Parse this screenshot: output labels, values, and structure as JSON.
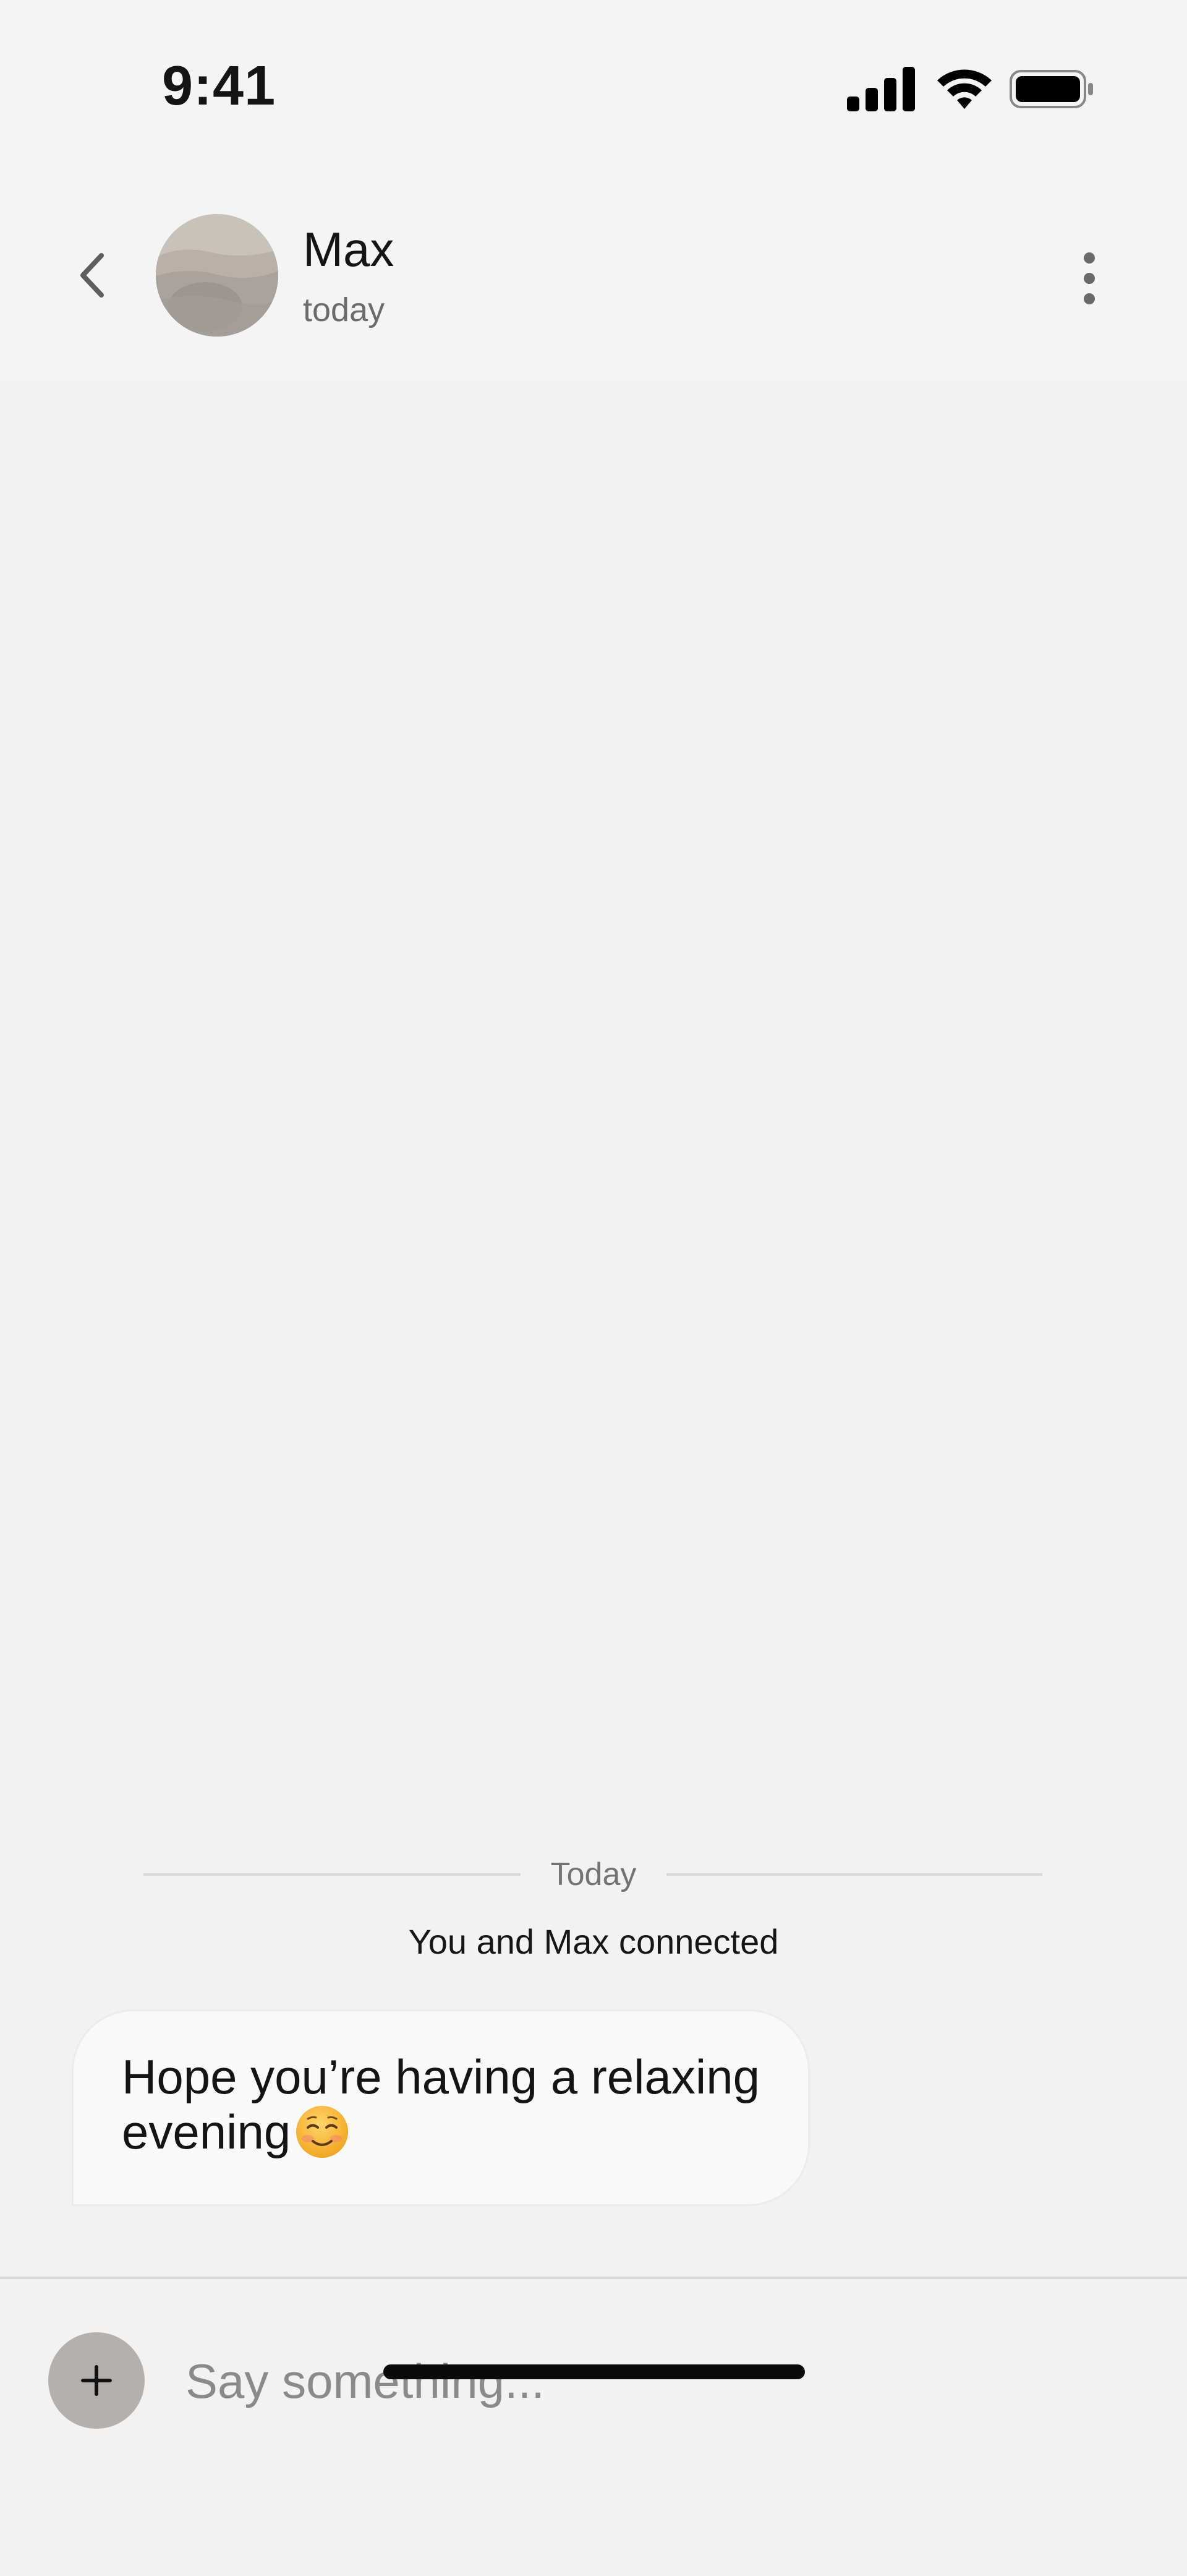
{
  "status_bar": {
    "time": "9:41",
    "icons": [
      "cellular-signal-icon",
      "wifi-icon",
      "battery-icon"
    ]
  },
  "header": {
    "back_icon": "chevron-left-icon",
    "contact_name": "Max",
    "contact_status": "today",
    "more_icon": "more-vertical-icon"
  },
  "conversation": {
    "date_divider": "Today",
    "system_message": "You and Max connected",
    "messages": [
      {
        "sender": "Max",
        "text": "Hope you’re having a relaxing evening",
        "emoji": "smiling-face-icon"
      }
    ]
  },
  "composer": {
    "attach_icon": "plus-icon",
    "placeholder": "Say something...",
    "value": ""
  },
  "colors": {
    "background": "#f2f2f2",
    "header_background": "#f4f4f4",
    "bubble_background": "#f9f9f9",
    "attach_button": "#b4b0ae",
    "secondary_text": "#6b6b6b"
  }
}
